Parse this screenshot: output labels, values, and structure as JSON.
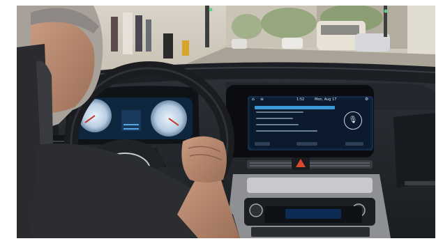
{
  "scene": {
    "description_icon": "car-interior-photo",
    "palette": {
      "dashboard": "#22262c",
      "screen_glow": "#3a9ad8",
      "hazard": "#d84a2c",
      "street": "#b9b2a6",
      "sky": "#d8d6cf"
    }
  },
  "infotainment": {
    "time": "1:52",
    "date": "Mon, Aug 17",
    "icons": [
      "home-icon",
      "back-icon",
      "settings-icon",
      "microphone-icon"
    ]
  },
  "climate": {
    "display_icon": "climate-display"
  }
}
